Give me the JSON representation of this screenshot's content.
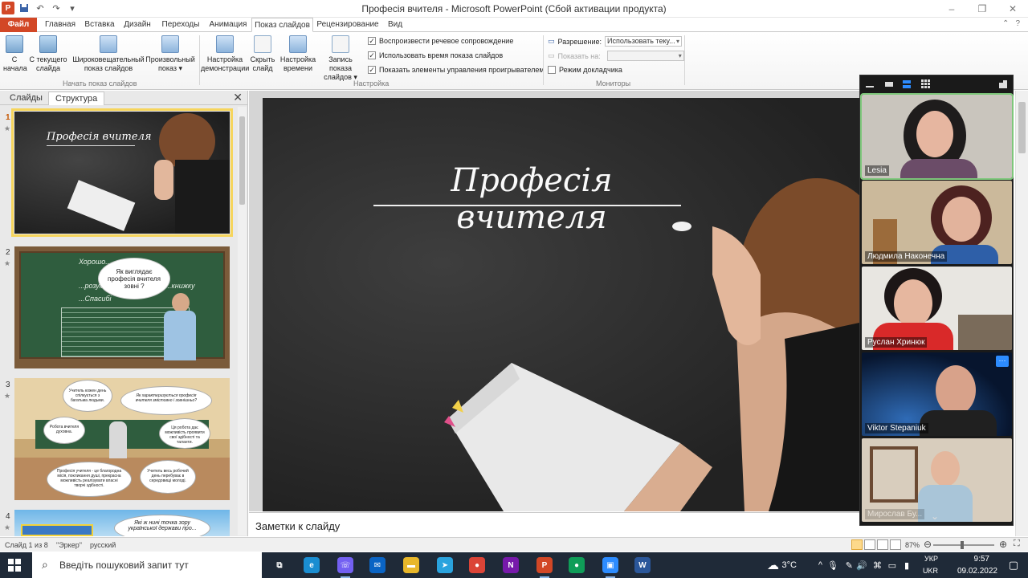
{
  "window": {
    "title": "Професія вчителя  -  Microsoft PowerPoint (Сбой активации продукта)",
    "controls": [
      "–",
      "❐",
      "✕"
    ]
  },
  "qat": [
    "↶",
    "↷",
    "▾"
  ],
  "ribbon_tabs": [
    {
      "label": "Файл",
      "kind": "file"
    },
    {
      "label": "Главная",
      "kind": "normal"
    },
    {
      "label": "Вставка",
      "kind": "normal"
    },
    {
      "label": "Дизайн",
      "kind": "normal"
    },
    {
      "label": "Переходы",
      "kind": "normal"
    },
    {
      "label": "Анимация",
      "kind": "normal"
    },
    {
      "label": "Показ слайдов",
      "kind": "active"
    },
    {
      "label": "Рецензирование",
      "kind": "normal"
    },
    {
      "label": "Вид",
      "kind": "normal"
    }
  ],
  "ribbon": {
    "start_group": {
      "label": "Начать показ слайдов",
      "buttons": [
        {
          "line1": "С",
          "line2": "начала",
          "icon": "projector-icon"
        },
        {
          "line1": "С текущего",
          "line2": "слайда",
          "icon": "projector-icon"
        },
        {
          "line1": "Широковещательный",
          "line2": "показ слайдов",
          "icon": "broadcast-icon"
        },
        {
          "line1": "Произвольный",
          "line2": "показ ▾",
          "icon": "custom-show-icon"
        }
      ]
    },
    "setup_group": {
      "label": "Настройка",
      "buttons": [
        {
          "line1": "Настройка",
          "line2": "демонстрации",
          "icon": "setup-icon"
        },
        {
          "line1": "Скрыть",
          "line2": "слайд",
          "icon": "hide-slide-icon"
        },
        {
          "line1": "Настройка",
          "line2": "времени",
          "icon": "timing-icon"
        },
        {
          "line1": "Запись показа",
          "line2": "слайдов ▾",
          "icon": "record-icon"
        }
      ],
      "checkboxes": [
        {
          "label": "Воспроизвести речевое сопровождение",
          "checked": true
        },
        {
          "label": "Использовать время показа слайдов",
          "checked": true
        },
        {
          "label": "Показать элементы управления проигрывателем",
          "checked": true
        }
      ]
    },
    "monitors_group": {
      "label": "Мониторы",
      "resolution_label": "Разрешение:",
      "resolution_value": "Использовать теку...",
      "show_on_label": "Показать на:",
      "show_on_value": "",
      "presenter_label": "Режим докладчика",
      "presenter_checked": false
    }
  },
  "left_panel": {
    "tabs": [
      "Слайды",
      "Структура"
    ],
    "close": "✕",
    "thumbnails": [
      {
        "number": "1",
        "title": "Професія вчителя",
        "selected": true
      },
      {
        "number": "2",
        "selected": false,
        "bubble": "Як виглядає професія вчителя зовні ?",
        "board": [
          "Хорошо...",
          "...розумних",
          "...книжку",
          "...Спасибі"
        ]
      },
      {
        "number": "3",
        "selected": false,
        "bubbles": [
          "Учитель кожен день спілкується з багатьма людьми.",
          "Як характеризується професія вчителя змістовно і зовнішньо?",
          "Робота вчителя духовна.",
          "Ця робота дає можливість проявити свої здібності та таланти.",
          "Професія учителя - це благородна місія, покликання душі, прекрасна можливість реалізувати власні творчі здібності.",
          "Учитель весь робочий день перебуває в середовищі молоді."
        ]
      },
      {
        "number": "4",
        "selected": false,
        "bubble": "Які ж нині точка зору української держави про..."
      }
    ]
  },
  "slide": {
    "title": "Професія вчителя"
  },
  "notes": {
    "placeholder": "Заметки к слайду"
  },
  "zoom": {
    "participants": [
      {
        "name": "Lesia",
        "active": true
      },
      {
        "name": "Людмила Наконечна",
        "active": false
      },
      {
        "name": "Руслан Хринюк",
        "active": false
      },
      {
        "name": "Viktor Stepaniuk",
        "active": false
      },
      {
        "name": "Мирослав Бу...",
        "active": false
      }
    ],
    "more_label": "···",
    "collapse": "⌄"
  },
  "statusbar": {
    "slide_info": "Слайд 1 из 8",
    "theme": "\"Эркер\"",
    "language": "русский",
    "zoom_level": "87%"
  },
  "taskbar": {
    "search_placeholder": "Введіть пошуковий запит тут",
    "weather": "3°C",
    "lang_top": "УКР",
    "lang_bottom": "UKR",
    "time": "9:57",
    "date": "09.02.2022",
    "apps": [
      {
        "icon": "task-view-icon",
        "color": "#1f2a38",
        "glyph": "⧉"
      },
      {
        "icon": "edge-icon",
        "color": "#1a8dd1",
        "glyph": "e"
      },
      {
        "icon": "viber-icon",
        "color": "#7360f2",
        "glyph": "☏"
      },
      {
        "icon": "mail-icon",
        "color": "#0a64c4",
        "glyph": "✉"
      },
      {
        "icon": "explorer-icon",
        "color": "#e8b72a",
        "glyph": "▬"
      },
      {
        "icon": "telegram-icon",
        "color": "#2aa3de",
        "glyph": "➤"
      },
      {
        "icon": "chrome-icon",
        "color": "#db4437",
        "glyph": "●"
      },
      {
        "icon": "onenote-icon",
        "color": "#7719aa",
        "glyph": "N"
      },
      {
        "icon": "powerpoint-icon",
        "color": "#d24726",
        "glyph": "P"
      },
      {
        "icon": "chrome-alt-icon",
        "color": "#0f9d58",
        "glyph": "●"
      },
      {
        "icon": "zoom-icon",
        "color": "#2d8cff",
        "glyph": "▣"
      },
      {
        "icon": "word-icon",
        "color": "#2b579a",
        "glyph": "W"
      }
    ]
  }
}
